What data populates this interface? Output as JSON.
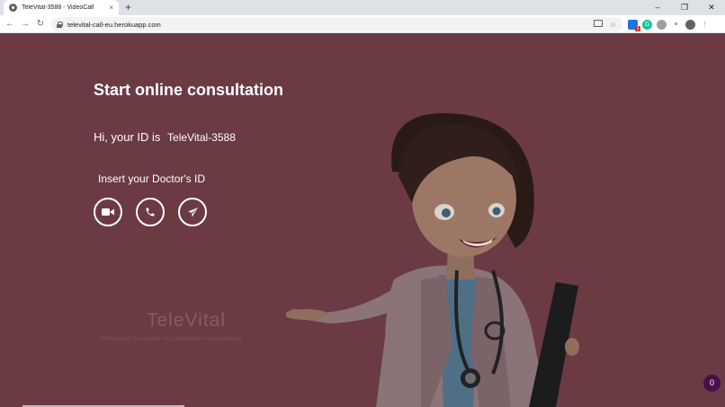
{
  "browser": {
    "tab_title": "TeleVital-3588 - VideoCall",
    "url": "televital-call-eu.herokuapp.com",
    "tab_close": "×",
    "new_tab": "+",
    "win_minimize": "–",
    "win_restore": "❐",
    "win_close": "✕",
    "back": "←",
    "forward": "→",
    "reload": "↻",
    "extension_badge": "1"
  },
  "page": {
    "heading": "Start online consultation",
    "id_prefix": "Hi, your ID is",
    "user_id": "TeleVital-3588",
    "doctor_id_label": "Insert your Doctor's ID",
    "buttons": [
      {
        "name": "video-call-button",
        "icon": "video-icon"
      },
      {
        "name": "voice-call-button",
        "icon": "phone-icon"
      },
      {
        "name": "send-message-button",
        "icon": "send-icon"
      }
    ],
    "brand_name": "TeleVital",
    "tagline": "Enhancing the quality of contactless measurement",
    "chat_counter": "0"
  },
  "colors": {
    "background": "#6b3a43",
    "accent_fab": "#4a0f4d",
    "white": "#ffffff"
  }
}
